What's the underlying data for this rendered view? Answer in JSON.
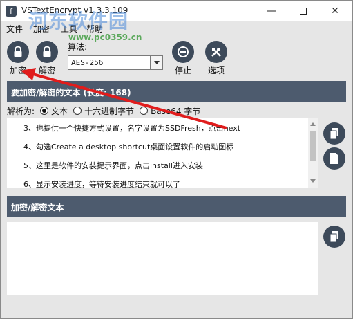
{
  "window": {
    "title": "VSTextEncrypt v1.3.3.109",
    "min_glyph": "—",
    "close_glyph": "✕"
  },
  "watermark": {
    "text": "河东软件园",
    "url": "www.pc0359.cn"
  },
  "menu": [
    "文件",
    "加密",
    "工具",
    "帮助"
  ],
  "toolbar": {
    "encrypt_label": "加密",
    "decrypt_label": "解密",
    "algorithm_label": "算法:",
    "algorithm_value": "AES-256",
    "stop_label": "停止",
    "options_label": "选项"
  },
  "input_section": {
    "header": "要加密/解密的文本 (长度: 168)",
    "parse_label": "解析为:",
    "parse_options": [
      "文本",
      "十六进制字节",
      "Base64 字节"
    ],
    "parse_selected": "文本",
    "lines": [
      "3、也提供一个快捷方式设置，名字设置为SSDFresh，点击next",
      "4、勾选Create a desktop shortcut桌面设置软件的启动图标",
      "5、这里是软件的安装提示界面，点击install进入安装",
      "6、显示安装进度，等待安装进度结束就可以了"
    ]
  },
  "output_section": {
    "header": "加密/解密文本"
  },
  "colors": {
    "header_bg": "#4d5b6e",
    "icon_bg": "#3d4a5a",
    "annotation_arrow": "#e01c1c"
  }
}
